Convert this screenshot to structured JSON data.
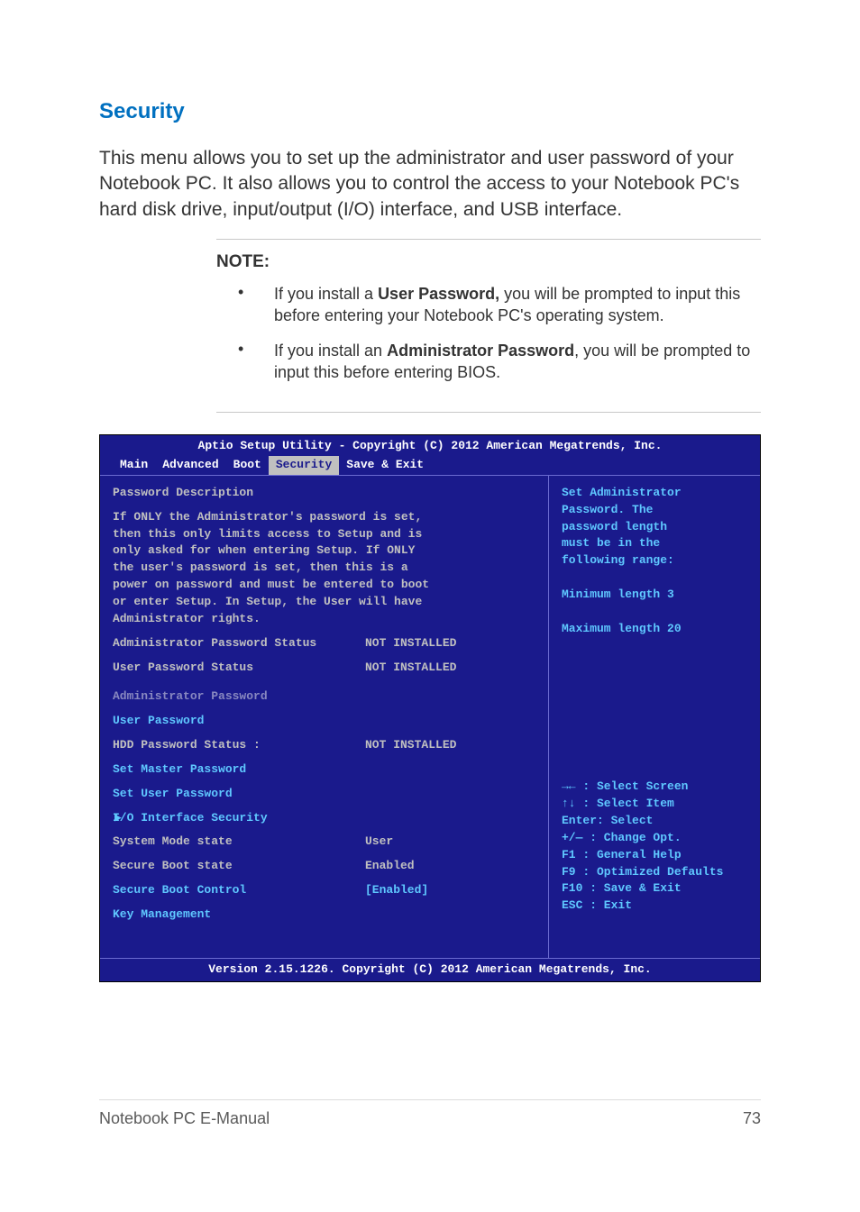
{
  "heading": "Security",
  "body": "This menu allows you to set up the administrator and user password of your Notebook PC. It also allows you to control the access to your Notebook PC's hard disk drive, input/output (I/O) interface, and USB interface.",
  "note": {
    "title": "NOTE:",
    "items": [
      {
        "prefix": "If you install a ",
        "bold": "User Password,",
        "suffix": " you will be prompted to input this before entering your Notebook PC's operating system."
      },
      {
        "prefix": "If you install an ",
        "bold": "Administrator Password",
        "suffix": ", you will be prompted to input this before entering BIOS."
      }
    ]
  },
  "bios": {
    "top": "Aptio Setup Utility - Copyright (C) 2012 American Megatrends, Inc.",
    "tabs": [
      "Main",
      "Advanced",
      "Boot",
      "Security",
      "Save & Exit"
    ],
    "active_tab": "Security",
    "desc_title": "Password Description",
    "desc_lines": [
      "If ONLY the Administrator's password is set,",
      "then this only limits access to Setup and is",
      "only asked for when entering Setup. If ONLY",
      "the user's password is set, then this is a",
      "power on password and must be entered to boot",
      "or enter Setup. In Setup, the User will have",
      "Administrator rights."
    ],
    "rows": {
      "admin_status": {
        "label": "Administrator Password Status",
        "val": "NOT INSTALLED"
      },
      "user_status": {
        "label": "User Password Status",
        "val": "NOT INSTALLED"
      },
      "admin_pw": {
        "label": "Administrator Password"
      },
      "user_pw": {
        "label": "User Password"
      },
      "hdd_status": {
        "label": "HDD Password Status :",
        "val": "NOT INSTALLED"
      },
      "set_master": {
        "label": "Set Master Password"
      },
      "set_user": {
        "label": "Set User Password"
      },
      "io_if": {
        "label": "I/O Interface Security"
      },
      "sys_mode": {
        "label": "System Mode state",
        "val": "User"
      },
      "sec_boot": {
        "label": "Secure Boot state",
        "val": "Enabled"
      },
      "sec_ctrl": {
        "label": "Secure Boot Control",
        "val": "[Enabled]"
      },
      "key_mgmt": {
        "label": "Key Management"
      }
    },
    "help_top": [
      "Set Administrator",
      "Password. The",
      "password length",
      "must be in the",
      "following range:",
      "",
      "Minimum length 3",
      "",
      "Maximum length 20"
    ],
    "help_bottom": [
      "→←  : Select Screen",
      "↑↓  : Select Item",
      "Enter: Select",
      "+/—  : Change Opt.",
      "F1   : General Help",
      "F9   : Optimized Defaults",
      "F10  : Save & Exit",
      "ESC  : Exit"
    ],
    "footer": "Version 2.15.1226. Copyright (C) 2012 American Megatrends, Inc."
  },
  "page_footer": {
    "left": "Notebook PC E-Manual",
    "right": "73"
  }
}
